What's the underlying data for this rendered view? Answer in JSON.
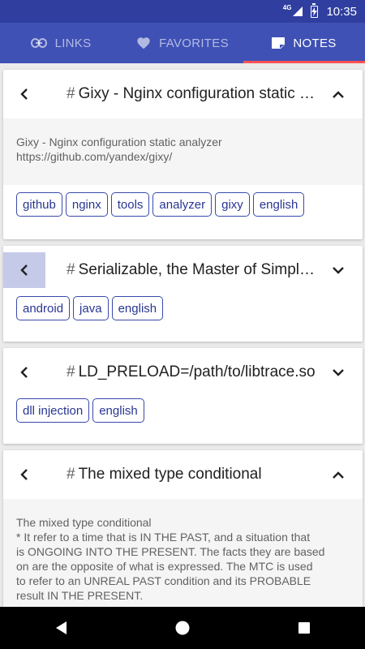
{
  "status": {
    "network": "4G",
    "time": "10:35"
  },
  "tabs": [
    {
      "label": "LINKS",
      "icon": "link-icon"
    },
    {
      "label": "FAVORITES",
      "icon": "heart-icon"
    },
    {
      "label": "NOTES",
      "icon": "note-icon"
    }
  ],
  "active_tab": "NOTES",
  "colors": {
    "primary": "#3f51b5",
    "primary_dark": "#303f9f",
    "accent": "#ff5252",
    "tag": "#3949ab"
  },
  "notes": [
    {
      "title": "Gixy - Nginx configuration static analyzer",
      "expanded": true,
      "body": [
        "Gixy - Nginx configuration static analyzer",
        "https://github.com/yandex/gixy/"
      ],
      "tags": [
        "github",
        "nginx",
        "tools",
        "analyzer",
        "gixy",
        "english"
      ]
    },
    {
      "title": "Serializable, the Master of Simplicity",
      "expanded": false,
      "tags": [
        "android",
        "java",
        "english"
      ]
    },
    {
      "title": "LD_PRELOAD=/path/to/libtrace.so",
      "expanded": false,
      "tags": [
        "dll injection",
        "english"
      ]
    },
    {
      "title": "The mixed type conditional",
      "expanded": true,
      "body": [
        "The mixed type conditional",
        "* It refer to a time that is IN THE PAST, and a situation that",
        "is ONGOING INTO THE PRESENT. The facts they are based",
        "on are the opposite of what is expressed. The MTC is used",
        "to refer to an UNREAL PAST condition and its PROBABLE",
        "result IN THE PRESENT."
      ]
    }
  ]
}
